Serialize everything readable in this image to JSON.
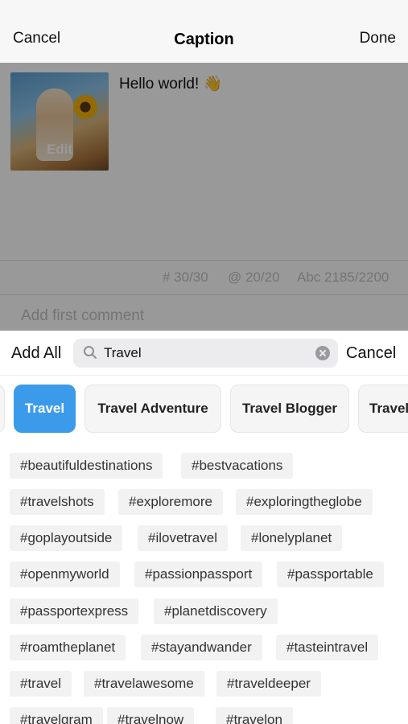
{
  "nav": {
    "cancel_label": "Cancel",
    "title": "Caption",
    "done_label": "Done"
  },
  "editor": {
    "thumbnail_edit_label": "Edit",
    "caption": "Hello world! 👋",
    "counters": {
      "hashtags": "# 30/30",
      "mentions": "@ 20/20",
      "characters": "Abc 2185/2200"
    },
    "first_comment_placeholder": "Add first comment"
  },
  "search": {
    "add_all_label": "Add All",
    "value": "Travel",
    "cancel_label": "Cancel",
    "icon": "search-icon"
  },
  "chips": [
    "Travel",
    "Travel Adventure",
    "Travel Blogger",
    "Travel"
  ],
  "chip_active_color": "#3b9bea",
  "hashtags": [
    [
      "#beautifuldestinations",
      "#bestvacations"
    ],
    [
      "#travelshots",
      "#exploremore",
      "#exploringtheglobe"
    ],
    [
      "#goplayoutside",
      "#ilovetravel",
      "#lonelyplanet"
    ],
    [
      "#openmyworld",
      "#passionpassport",
      "#passportable"
    ],
    [
      "#passportexpress",
      "#planetdiscovery"
    ],
    [
      "#roamtheplanet",
      "#stayandwander",
      "#tasteintravel"
    ],
    [
      "#travel",
      "#travelawesome",
      "#traveldeeper"
    ],
    [
      "#travelgram",
      "#travelnow",
      "#travelon"
    ]
  ]
}
